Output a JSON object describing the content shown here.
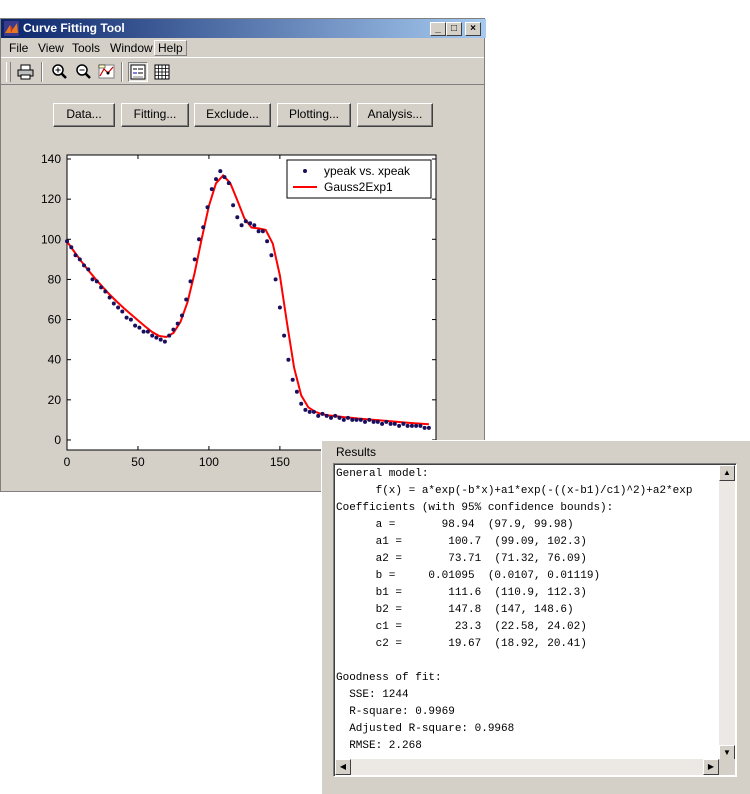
{
  "window": {
    "title": "Curve Fitting Tool",
    "caption_buttons": {
      "minimize": "_",
      "maximize": "□",
      "close": "×"
    }
  },
  "menu": [
    "File",
    "View",
    "Tools",
    "Window",
    "Help"
  ],
  "toolbar_icons": [
    "printer-icon",
    "zoom-in-icon",
    "zoom-out-icon",
    "data-cursor-icon",
    "legend-icon",
    "grid-icon"
  ],
  "buttons": {
    "data": "Data...",
    "fitting": "Fitting...",
    "exclude": "Exclude...",
    "plotting": "Plotting...",
    "analysis": "Analysis..."
  },
  "colors": {
    "data_points": "#1a0f5c",
    "fit_line": "#ff0000"
  },
  "chart_data": {
    "type": "scatter",
    "title": "",
    "xlabel": "",
    "ylabel": "",
    "xlim": [
      0,
      260
    ],
    "ylim": [
      -5,
      142
    ],
    "xticks": [
      0,
      50,
      100,
      150
    ],
    "yticks": [
      0,
      20,
      40,
      60,
      80,
      100,
      120,
      140
    ],
    "grid": false,
    "legend_position": "top-right",
    "legend": [
      "ypeak vs. xpeak",
      "Gauss2Exp1"
    ],
    "series": [
      {
        "name": "ypeak vs. xpeak",
        "kind": "points",
        "x": [
          0,
          3,
          6,
          9,
          12,
          15,
          18,
          21,
          24,
          27,
          30,
          33,
          36,
          39,
          42,
          45,
          48,
          51,
          54,
          57,
          60,
          63,
          66,
          69,
          72,
          75,
          78,
          81,
          84,
          87,
          90,
          93,
          96,
          99,
          102,
          105,
          108,
          111,
          114,
          117,
          120,
          123,
          126,
          129,
          132,
          135,
          138,
          141,
          144,
          147,
          150,
          153,
          156,
          159,
          162,
          165,
          168,
          171,
          174,
          177,
          180,
          183,
          186,
          189,
          192,
          195,
          198,
          201,
          204,
          207,
          210,
          213,
          216,
          219,
          222,
          225,
          228,
          231,
          234,
          237,
          240,
          243,
          246,
          249,
          252,
          255
        ],
        "y": [
          99,
          96,
          92,
          90,
          87,
          85,
          80,
          79,
          76,
          74,
          71,
          68,
          66,
          64,
          61,
          60,
          57,
          56,
          54,
          54,
          52,
          51,
          50,
          49,
          52,
          55,
          58,
          62,
          70,
          79,
          90,
          100,
          106,
          116,
          125,
          130,
          134,
          131,
          128,
          117,
          111,
          107,
          109,
          108,
          107,
          104,
          104,
          99,
          92,
          80,
          66,
          52,
          40,
          30,
          24,
          18,
          15,
          14,
          14,
          12,
          13,
          12,
          11,
          12,
          11,
          10,
          11,
          10,
          10,
          10,
          9,
          10,
          9,
          9,
          8,
          9,
          8,
          8,
          7,
          8,
          7,
          7,
          7,
          7,
          6,
          6
        ]
      },
      {
        "name": "Gauss2Exp1",
        "kind": "line",
        "x": [
          0,
          5,
          10,
          15,
          20,
          25,
          30,
          35,
          40,
          45,
          50,
          55,
          60,
          65,
          70,
          75,
          80,
          85,
          90,
          95,
          100,
          105,
          110,
          115,
          120,
          125,
          130,
          135,
          140,
          145,
          150,
          155,
          160,
          165,
          170,
          175,
          180,
          185,
          190,
          195,
          200,
          205,
          210,
          215,
          220,
          225,
          230,
          235,
          240,
          245,
          250,
          255
        ],
        "y": [
          98.9,
          93.9,
          89.1,
          84.6,
          80.3,
          76.3,
          72.5,
          69.0,
          65.7,
          62.6,
          59.6,
          56.6,
          53.8,
          51.8,
          51.3,
          53.3,
          58.9,
          68.8,
          83.4,
          100.5,
          116.6,
          127.9,
          131.8,
          128.1,
          119.5,
          110.4,
          105.8,
          105.4,
          104.7,
          97.8,
          81.9,
          58.3,
          36.0,
          22.2,
          16.3,
          14.0,
          12.8,
          12.2,
          11.8,
          11.4,
          11.1,
          10.7,
          10.4,
          10.1,
          9.8,
          9.5,
          9.2,
          8.9,
          8.6,
          8.3,
          8.1,
          7.8
        ]
      }
    ]
  },
  "results": {
    "title": "Results",
    "lines": [
      "General model:",
      "      f(x) = a*exp(-b*x)+a1*exp(-((x-b1)/c1)^2)+a2*exp",
      "Coefficients (with 95% confidence bounds):",
      "      a =       98.94  (97.9, 99.98)",
      "      a1 =       100.7  (99.09, 102.3)",
      "      a2 =       73.71  (71.32, 76.09)",
      "      b =     0.01095  (0.0107, 0.01119)",
      "      b1 =       111.6  (110.9, 112.3)",
      "      b2 =       147.8  (147, 148.6)",
      "      c1 =        23.3  (22.58, 24.02)",
      "      c2 =       19.67  (18.92, 20.41)",
      "",
      "Goodness of fit:",
      "  SSE: 1244",
      "  R-square: 0.9969",
      "  Adjusted R-square: 0.9968",
      "  RMSE: 2.268"
    ]
  },
  "scroll_arrows": {
    "up": "▲",
    "down": "▼",
    "left": "◀",
    "right": "▶"
  }
}
